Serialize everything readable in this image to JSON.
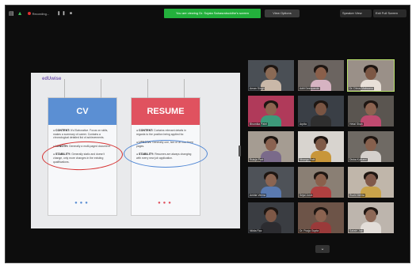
{
  "topbar": {
    "recording_label": "Recording...",
    "share_banner": "You are viewing Dr. Sujata Sahasrabuddhe's screen",
    "view_options": "View Options",
    "speaker_view": "Speaker View",
    "exit_full_screen": "Exit Full Screen"
  },
  "slide": {
    "logo": "edUwise",
    "cv": {
      "heading": "CV",
      "items": [
        {
          "term": "CONTENT:",
          "text": "It's Elaborative. Focus on skills, makes a summary of career. Contains a chronological detailed list of achievements."
        },
        {
          "term": "LENGTH:",
          "text": "Generally a multi-paged document."
        },
        {
          "term": "STABILITY:",
          "text": "Generally static and doesn't change, only more changes in the existing qualifications."
        }
      ]
    },
    "resume": {
      "heading": "RESUME",
      "items": [
        {
          "term": "CONTENT:",
          "text": "Contains relevant details in regards to the position being applied for."
        },
        {
          "term": "LENGTH:",
          "text": "Generally one, two or at max three pages."
        },
        {
          "term": "STABILITY:",
          "text": "Resumes are always changing with every new job application."
        }
      ]
    }
  },
  "participants": [
    {
      "name": "Aman Singh",
      "skin": "#8a6a55",
      "shirt": "#c9b8a8",
      "bg": "#4a4f55",
      "active": false
    },
    {
      "name": "Aditi Deshpande",
      "skin": "#8a5f4a",
      "shirt": "#d6b3c2",
      "bg": "#6b6460",
      "active": false
    },
    {
      "name": "Dr. Dhruv Makwana",
      "skin": "#7c5744",
      "shirt": "#e8e0d8",
      "bg": "#9a9088",
      "active": true
    },
    {
      "name": "Bhumika Patel",
      "skin": "#8e6450",
      "shirt": "#3d9a7a",
      "bg": "#b03a5a",
      "active": false
    },
    {
      "name": "Arpita",
      "skin": "#7a5543",
      "shirt": "#2f2f2f",
      "bg": "#3a3f46",
      "active": false
    },
    {
      "name": "Hetal Shah",
      "skin": "#8c6350",
      "shirt": "#c04a70",
      "bg": "#5a5550",
      "active": false
    },
    {
      "name": "Rutuja Patil",
      "skin": "#8a6250",
      "shirt": "#7a6a8a",
      "bg": "#a59c92",
      "active": false
    },
    {
      "name": "Nisarga Patil",
      "skin": "#7f5a47",
      "shirt": "#c8963a",
      "bg": "#d8d4cf",
      "active": false
    },
    {
      "name": "Disha Kulkarni",
      "skin": "#86604d",
      "shirt": "#d4d0cc",
      "bg": "#6f6a64",
      "active": false
    },
    {
      "name": "Ankita Verma",
      "skin": "#8b6552",
      "shirt": "#5a7ab0",
      "bg": "#4e5258",
      "active": false
    },
    {
      "name": "Sejal Joshi",
      "skin": "#8a604c",
      "shirt": "#b04040",
      "bg": "#8a7f74",
      "active": false
    },
    {
      "name": "Ruchi Mehta",
      "skin": "#80594a",
      "shirt": "#c9a34a",
      "bg": "#c0b6aa",
      "active": false
    },
    {
      "name": "Nikita Rao",
      "skin": "#7e5846",
      "shirt": "#2c2c30",
      "bg": "#3a3d42",
      "active": false
    },
    {
      "name": "Dr. Pooja Gupta",
      "skin": "#8b6350",
      "shirt": "#9a3a3a",
      "bg": "#6d5448",
      "active": false
    },
    {
      "name": "Sakshi Jain",
      "skin": "#8d6856",
      "shirt": "#e2ddd8",
      "bg": "#bdb5ad",
      "active": false
    }
  ],
  "more_label": "⌄"
}
